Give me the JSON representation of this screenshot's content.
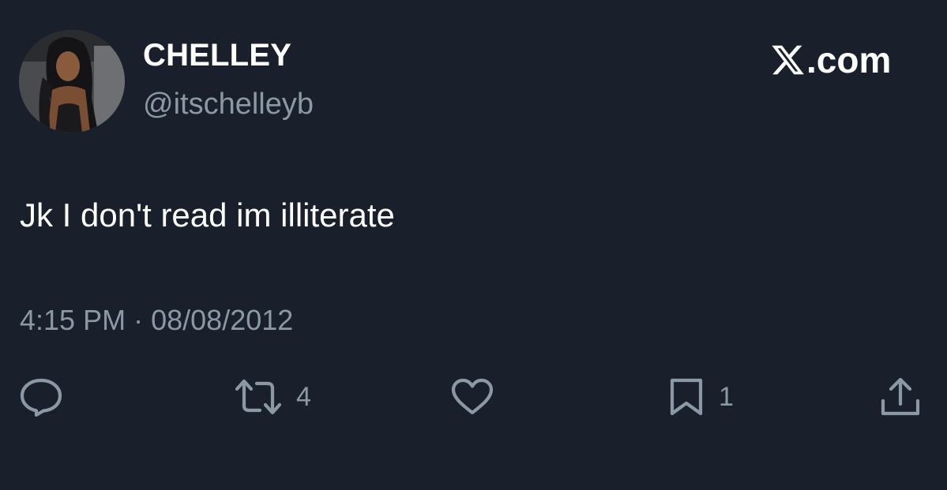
{
  "user": {
    "display_name": "CHELLEY",
    "handle": "@itschelleyb"
  },
  "brand": {
    "icon": "x-logo-icon",
    "text": ".com"
  },
  "tweet": {
    "text": "Jk I don't read im illiterate",
    "time": "4:15 PM",
    "separator": "·",
    "date": "08/08/2012"
  },
  "actions": {
    "reply": {
      "icon": "reply-icon",
      "count": ""
    },
    "retweet": {
      "icon": "retweet-icon",
      "count": "4"
    },
    "like": {
      "icon": "heart-icon",
      "count": ""
    },
    "bookmark": {
      "icon": "bookmark-icon",
      "count": "1"
    },
    "share": {
      "icon": "share-icon",
      "count": ""
    }
  },
  "colors": {
    "background": "#1a202b",
    "primary_text": "#ffffff",
    "secondary_text": "#8b98a5"
  }
}
